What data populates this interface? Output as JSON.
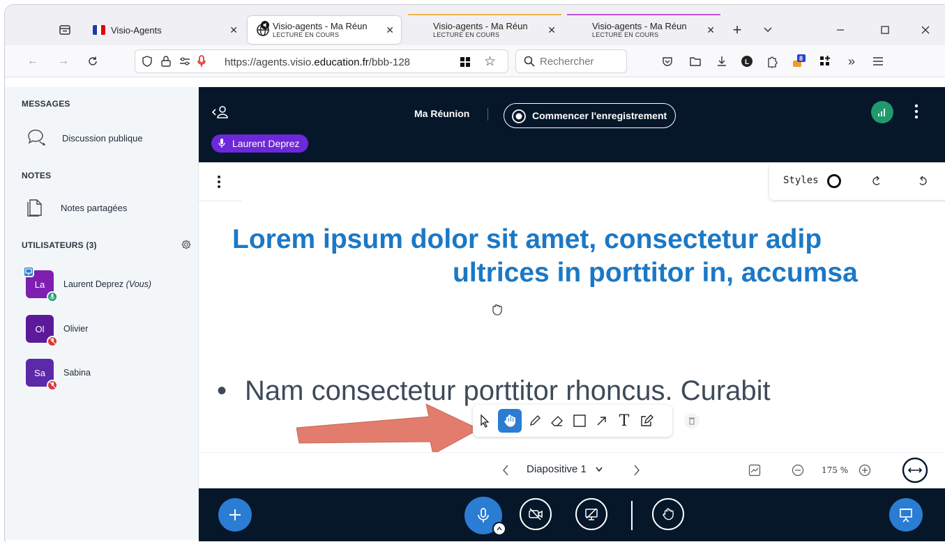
{
  "browser": {
    "tabs": [
      {
        "title": "Visio-Agents",
        "subtitle": ""
      },
      {
        "title": "Visio-agents - Ma Réun",
        "subtitle": "LECTURE EN COURS"
      },
      {
        "title": "Visio-agents - Ma Réun",
        "subtitle": "LECTURE EN COURS"
      },
      {
        "title": "Visio-agents - Ma Réun",
        "subtitle": "LECTURE EN COURS"
      }
    ],
    "url_prefix": "https://agents.visio.",
    "url_domain": "education.fr",
    "url_suffix": "/bbb-128",
    "search_placeholder": "Rechercher",
    "badge_count": "8"
  },
  "sidebar": {
    "messages_title": "MESSAGES",
    "public_chat": "Discussion publique",
    "notes_title": "NOTES",
    "shared_notes": "Notes partagées",
    "users_title": "UTILISATEURS (3)",
    "users": [
      {
        "initials": "La",
        "name": "Laurent Deprez",
        "suffix": "(Vous)",
        "color": "#7e1fb0"
      },
      {
        "initials": "Ol",
        "name": "Olivier",
        "suffix": "",
        "color": "#5b1a99"
      },
      {
        "initials": "Sa",
        "name": "Sabina",
        "suffix": "",
        "color": "#5b2aa8"
      }
    ]
  },
  "meeting": {
    "title": "Ma Réunion",
    "record_label": "Commencer l'enregistrement",
    "speaker": "Laurent Deprez"
  },
  "presentation": {
    "styles_label": "Styles",
    "title_line1": "Lorem ipsum dolor sit amet, consectetur adip",
    "title_line2": "ultrices in porttitor in, accumsa",
    "bullet": "Nam consectetur porttitor rhoncus. Curabit",
    "slide_label": "Diapositive 1",
    "zoom": "175 %"
  },
  "colors": {
    "dark_bg": "#06172a",
    "accent_blue": "#2b7cd3",
    "title_blue": "#1b78c6",
    "arrow": "#e27d6e"
  }
}
